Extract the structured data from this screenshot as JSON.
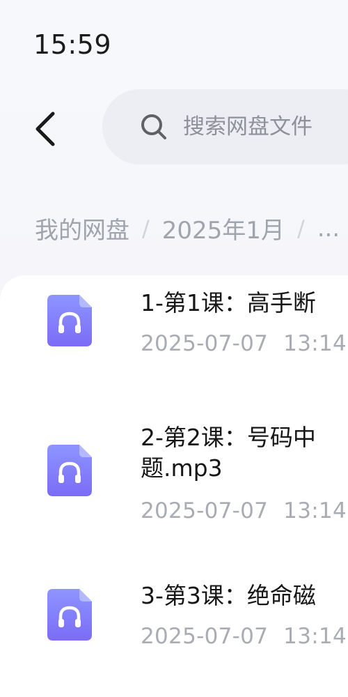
{
  "status_bar": {
    "time": "15:59"
  },
  "header": {
    "back_icon": "chevron-left-icon",
    "search": {
      "icon": "search-icon",
      "placeholder": "搜索网盘文件"
    }
  },
  "breadcrumb": {
    "items": [
      "我的网盘",
      "2025年1月",
      "..."
    ],
    "separator": "/"
  },
  "colors": {
    "accent_icon_top": "#8d95ff",
    "accent_icon_bottom": "#7b6cf6",
    "meta_text": "#a9acb3",
    "breadcrumb_text": "#a0a4ad"
  },
  "files": [
    {
      "title_lines": [
        "1-第1课：高手断"
      ],
      "date": "2025-07-07",
      "time": "13:14",
      "icon": "audio-file-icon"
    },
    {
      "title_lines": [
        "2-第2课：号码中",
        "题.mp3"
      ],
      "date": "2025-07-07",
      "time": "13:14",
      "icon": "audio-file-icon"
    },
    {
      "title_lines": [
        "3-第3课：绝命磁"
      ],
      "date": "2025-07-07",
      "time": "13:14",
      "icon": "audio-file-icon"
    }
  ]
}
